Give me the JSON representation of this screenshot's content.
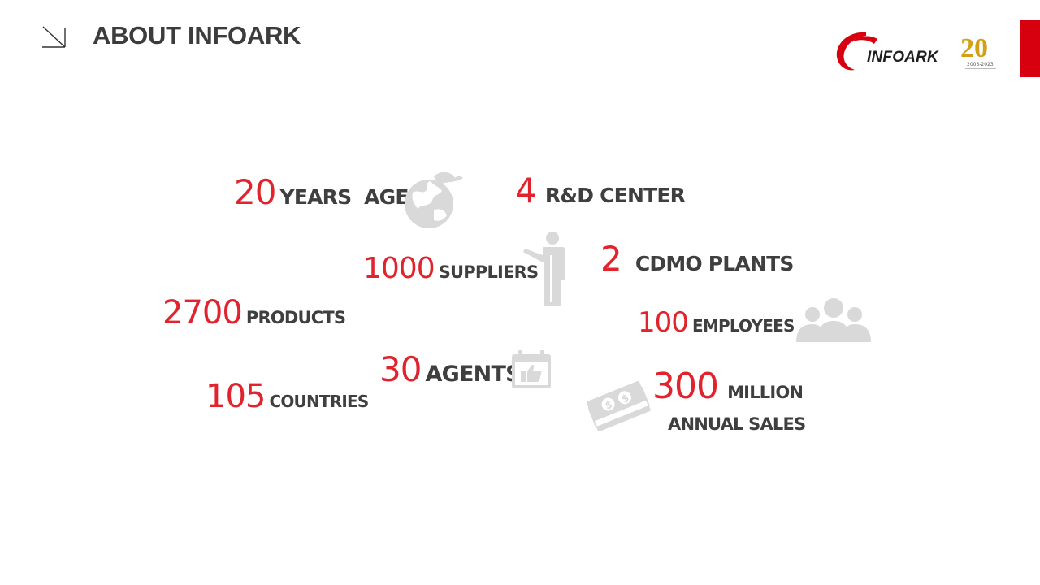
{
  "header": {
    "title": "ABOUT INFOARK",
    "logo_text": "INFOARK",
    "anniversary_number": "20",
    "anniversary_years": "2003-2023"
  },
  "stats": [
    {
      "id": "years",
      "value": "20",
      "label": "YEARS  AGE"
    },
    {
      "id": "rd",
      "value": "4",
      "label": "R&D CENTER"
    },
    {
      "id": "suppliers",
      "value": "1000",
      "label": "SUPPLIERS"
    },
    {
      "id": "cdmo",
      "value": "2",
      "label": "CDMO PLANTS"
    },
    {
      "id": "products",
      "value": "2700",
      "label": "PRODUCTS"
    },
    {
      "id": "employees",
      "value": "100",
      "label": "EMPLOYEES"
    },
    {
      "id": "agents",
      "value": "30",
      "label": "AGENTS"
    },
    {
      "id": "countries",
      "value": "105",
      "label": "COUNTRIES"
    },
    {
      "id": "sales",
      "value": "300",
      "label": "MILLION",
      "label2": "ANNUAL SALES"
    }
  ],
  "icons": [
    "globe-icon",
    "presenter-icon",
    "group-icon",
    "calendar-thumbs-up-icon",
    "money-stack-icon"
  ],
  "colors": {
    "accent": "#e0232d",
    "brand_red": "#d7000f",
    "text_dark": "#3f3f3f",
    "icon_gray": "#d9d9d9",
    "gold": "#d4a017"
  }
}
